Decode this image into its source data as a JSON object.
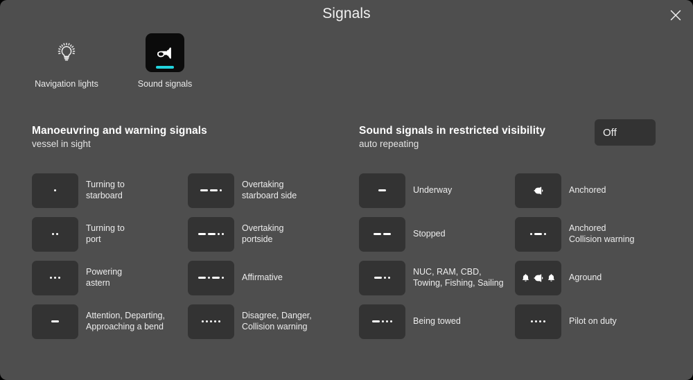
{
  "window": {
    "title": "Signals",
    "close_icon": "close-icon",
    "bg_color": "#4e4e4e",
    "tile_color": "#333333",
    "accent_color": "#22d3dd"
  },
  "tabs": [
    {
      "label": "Navigation lights",
      "icon": "lightbulb-icon",
      "active": false
    },
    {
      "label": "Sound signals",
      "icon": "horn-icon",
      "active": true
    }
  ],
  "sections": {
    "left": {
      "title": "Manoeuvring and warning signals",
      "subtitle": "vessel in sight"
    },
    "right": {
      "title": "Sound signals in restricted visibility",
      "subtitle": "auto repeating",
      "toggle_label": "Off"
    }
  },
  "columns": [
    {
      "id": "manoeuvring-col-1",
      "items": [
        {
          "pattern": [
            "dot"
          ],
          "label": "Turning to\nstarboard"
        },
        {
          "pattern": [
            "dot",
            "dot"
          ],
          "label": "Turning to\nport"
        },
        {
          "pattern": [
            "dot",
            "dot",
            "dot"
          ],
          "label": "Powering\nastern"
        },
        {
          "pattern": [
            "dash"
          ],
          "label": "Attention, Departing,\nApproaching a bend"
        }
      ]
    },
    {
      "id": "manoeuvring-col-2",
      "items": [
        {
          "pattern": [
            "dash",
            "dash",
            "dot"
          ],
          "label": "Overtaking\nstarboard side"
        },
        {
          "pattern": [
            "dash",
            "dash",
            "dot",
            "dot"
          ],
          "label": "Overtaking\nportside"
        },
        {
          "pattern": [
            "dash",
            "dot",
            "dash",
            "dot"
          ],
          "label": "Affirmative"
        },
        {
          "pattern": [
            "dot",
            "dot",
            "dot",
            "dot",
            "dot"
          ],
          "label": "Disagree, Danger,\nCollision warning"
        }
      ]
    },
    {
      "id": "restricted-col-1",
      "items": [
        {
          "pattern": [
            "dash"
          ],
          "label": "Underway"
        },
        {
          "pattern": [
            "dash",
            "dash"
          ],
          "label": "Stopped"
        },
        {
          "pattern": [
            "dash",
            "dot",
            "dot"
          ],
          "label": "NUC, RAM, CBD,\nTowing, Fishing, Sailing"
        },
        {
          "pattern": [
            "dash",
            "dot",
            "dot",
            "dot"
          ],
          "label": "Being towed"
        }
      ]
    },
    {
      "id": "restricted-col-2",
      "items": [
        {
          "pattern": [
            "bell-right"
          ],
          "label": "Anchored"
        },
        {
          "pattern": [
            "dot",
            "dash",
            "dot"
          ],
          "label": "Anchored\nCollision warning"
        },
        {
          "pattern": [
            "bell-up",
            "bell-right",
            "bell-up"
          ],
          "label": "Aground"
        },
        {
          "pattern": [
            "dot",
            "dot",
            "dot",
            "dot"
          ],
          "label": "Pilot on duty"
        }
      ]
    }
  ]
}
